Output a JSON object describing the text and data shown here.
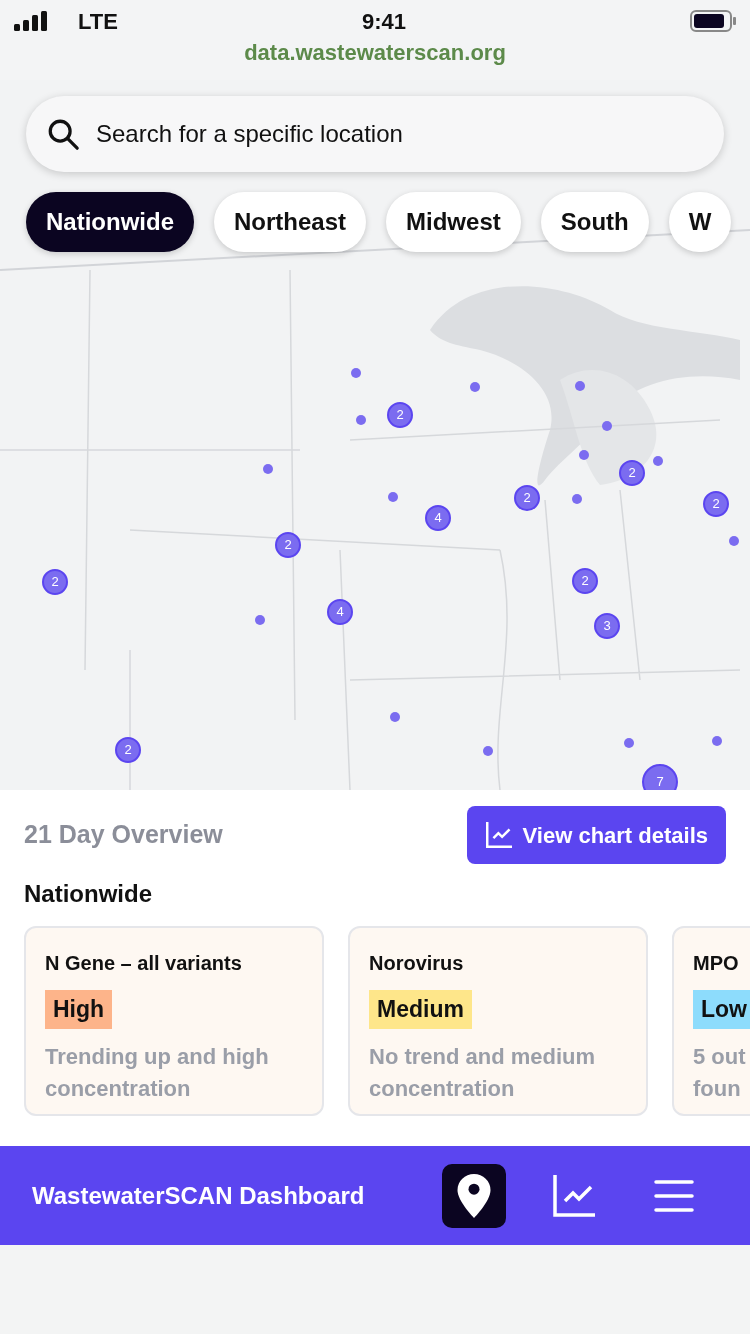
{
  "status_bar": {
    "carrier": "LTE",
    "time": "9:41",
    "url": "data.wastewaterscan.org"
  },
  "search": {
    "placeholder": "Search for a specific location"
  },
  "regions": [
    {
      "label": "Nationwide",
      "selected": true
    },
    {
      "label": "Northeast",
      "selected": false
    },
    {
      "label": "Midwest",
      "selected": false
    },
    {
      "label": "South",
      "selected": false
    },
    {
      "label": "W",
      "selected": false
    }
  ],
  "map": {
    "clusters": [
      "2",
      "2",
      "2",
      "2",
      "4",
      "2",
      "2",
      "2",
      "4",
      "3",
      "2",
      "7"
    ]
  },
  "overview": {
    "title": "21 Day Overview",
    "button": "View chart details",
    "region": "Nationwide",
    "cards": [
      {
        "name": "N Gene – all variants",
        "color": "#fdb48a",
        "level_label": "High",
        "description": [
          "Trending up and high",
          "concentration"
        ]
      },
      {
        "name": "Norovirus",
        "color": "#fee68a",
        "level_label": "Medium",
        "description": [
          "No trend and medium",
          "concentration"
        ]
      },
      {
        "name": "MPO",
        "color": "#8ddcfc",
        "level_label": "Low",
        "description": [
          "5 out",
          "foun"
        ]
      }
    ]
  },
  "nav": {
    "title": "WastewaterSCAN Dashboard",
    "items": [
      {
        "kind": "map",
        "selected": true
      },
      {
        "kind": "chart",
        "selected": false
      },
      {
        "kind": "menu",
        "selected": false
      }
    ]
  }
}
